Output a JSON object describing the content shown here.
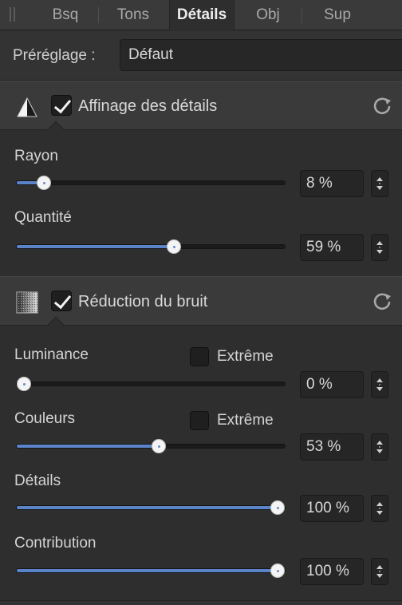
{
  "tabs": [
    {
      "label": "Bsq",
      "active": false
    },
    {
      "label": "Tons",
      "active": false
    },
    {
      "label": "Détails",
      "active": true
    },
    {
      "label": "Obj",
      "active": false
    },
    {
      "label": "Sup",
      "active": false
    }
  ],
  "preset": {
    "label": "Préréglage :",
    "value": "Défaut"
  },
  "sharpening": {
    "title": "Affinage des détails",
    "enabled": true,
    "icon": "triangle-icon",
    "sliders": [
      {
        "label": "Rayon",
        "value": "8 %",
        "level": 0.08
      },
      {
        "label": "Quantité",
        "value": "59 %",
        "level": 0.59
      }
    ]
  },
  "noise": {
    "title": "Réduction du bruit",
    "enabled": true,
    "icon": "noise-icon",
    "sliders": [
      {
        "label": "Luminance",
        "value": "0 %",
        "level": 0.0,
        "extreme_label": "Extrême",
        "extreme": false
      },
      {
        "label": "Couleurs",
        "value": "53 %",
        "level": 0.53,
        "extreme_label": "Extrême",
        "extreme": false
      },
      {
        "label": "Détails",
        "value": "100 %",
        "level": 1.0
      },
      {
        "label": "Contribution",
        "value": "100 %",
        "level": 1.0
      }
    ]
  },
  "colors": {
    "accent": "#5b83c8",
    "background": "#2e2e2e",
    "header": "#3a3a3a"
  }
}
